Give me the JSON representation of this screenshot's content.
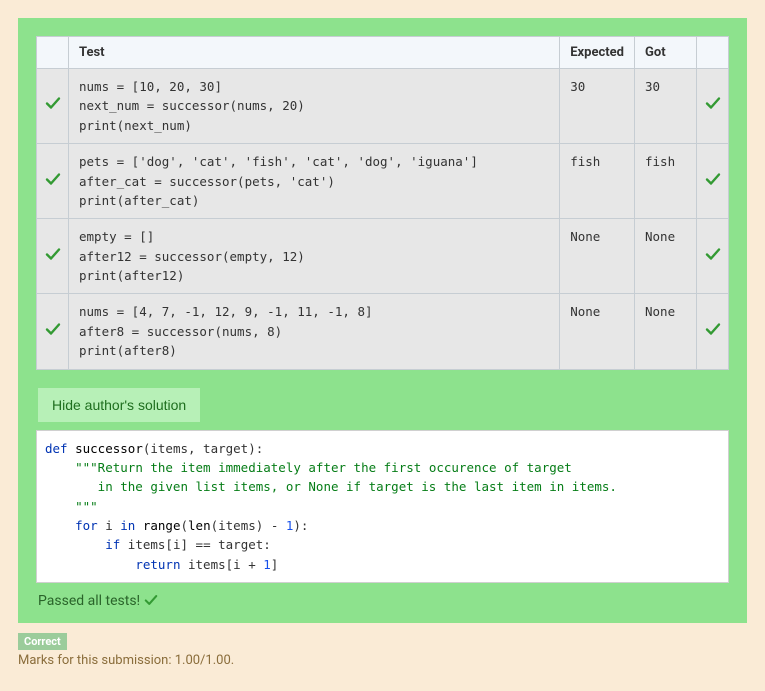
{
  "table": {
    "headers": {
      "test": "Test",
      "expected": "Expected",
      "got": "Got"
    },
    "rows": [
      {
        "test": "nums = [10, 20, 30]\nnext_num = successor(nums, 20)\nprint(next_num)",
        "expected": "30",
        "got": "30"
      },
      {
        "test": "pets = ['dog', 'cat', 'fish', 'cat', 'dog', 'iguana']\nafter_cat = successor(pets, 'cat')\nprint(after_cat)",
        "expected": "fish",
        "got": "fish"
      },
      {
        "test": "empty = []\nafter12 = successor(empty, 12)\nprint(after12)",
        "expected": "None",
        "got": "None"
      },
      {
        "test": "nums = [4, 7, -1, 12, 9, -1, 11, -1, 8]\nafter8 = successor(nums, 8)\nprint(after8)",
        "expected": "None",
        "got": "None"
      }
    ]
  },
  "solution_button": "Hide author's solution",
  "solution_code": {
    "plain": "def successor(items, target):\n    \"\"\"Return the item immediately after the first occurence of target\n       in the given list items, or None if target is the last item in items.\n    \"\"\"\n    for i in range(len(items) - 1):\n        if items[i] == target:\n            return items[i + 1]"
  },
  "passed_text": "Passed all tests!",
  "correct_badge": "Correct",
  "marks_text": "Marks for this submission: 1.00/1.00."
}
